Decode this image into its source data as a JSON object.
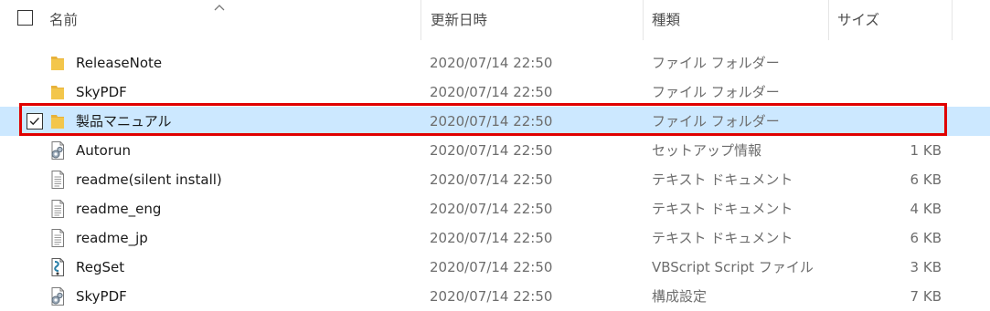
{
  "header": {
    "name": "名前",
    "date": "更新日時",
    "type": "種類",
    "size": "サイズ"
  },
  "files": [
    {
      "name": "ReleaseNote",
      "date": "2020/07/14 22:50",
      "type": "ファイル フォルダー",
      "size": "",
      "icon": "folder-icon",
      "selected": false
    },
    {
      "name": "SkyPDF",
      "date": "2020/07/14 22:50",
      "type": "ファイル フォルダー",
      "size": "",
      "icon": "folder-icon",
      "selected": false
    },
    {
      "name": "製品マニュアル",
      "date": "2020/07/14 22:50",
      "type": "ファイル フォルダー",
      "size": "",
      "icon": "folder-icon",
      "selected": true
    },
    {
      "name": "Autorun",
      "date": "2020/07/14 22:50",
      "type": "セットアップ情報",
      "size": "1 KB",
      "icon": "setup-info-icon",
      "selected": false
    },
    {
      "name": "readme(silent install)",
      "date": "2020/07/14 22:50",
      "type": "テキスト ドキュメント",
      "size": "6 KB",
      "icon": "text-document-icon",
      "selected": false
    },
    {
      "name": "readme_eng",
      "date": "2020/07/14 22:50",
      "type": "テキスト ドキュメント",
      "size": "4 KB",
      "icon": "text-document-icon",
      "selected": false
    },
    {
      "name": "readme_jp",
      "date": "2020/07/14 22:50",
      "type": "テキスト ドキュメント",
      "size": "6 KB",
      "icon": "text-document-icon",
      "selected": false
    },
    {
      "name": "RegSet",
      "date": "2020/07/14 22:50",
      "type": "VBScript Script ファイル",
      "size": "3 KB",
      "icon": "vbscript-icon",
      "selected": false
    },
    {
      "name": "SkyPDF",
      "date": "2020/07/14 22:50",
      "type": "構成設定",
      "size": "7 KB",
      "icon": "config-settings-icon",
      "selected": false
    }
  ],
  "colors": {
    "selected_bg": "#cce8ff",
    "highlight_outline": "#e00000",
    "folder": "#f3c64b"
  }
}
